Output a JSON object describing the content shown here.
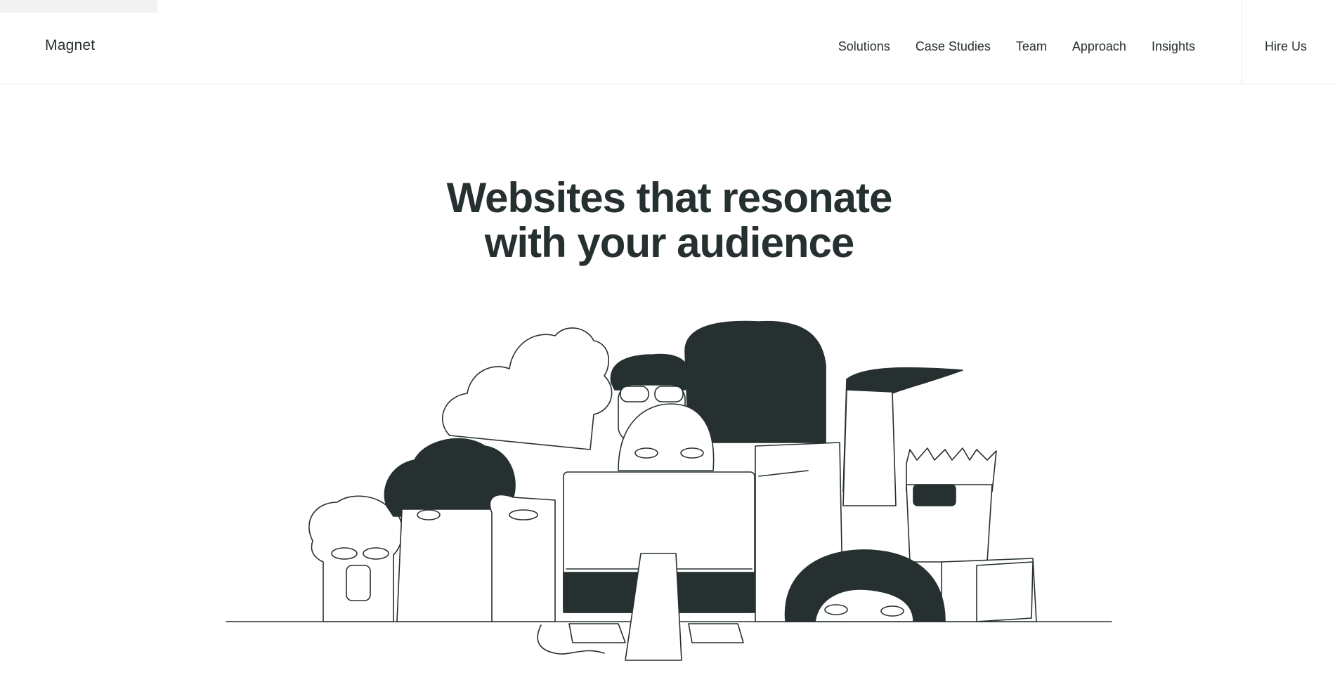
{
  "brand": {
    "name": "Magnet"
  },
  "nav": {
    "items": [
      {
        "label": "Solutions"
      },
      {
        "label": "Case Studies"
      },
      {
        "label": "Team"
      },
      {
        "label": "Approach"
      },
      {
        "label": "Insights"
      }
    ],
    "cta_label": "Hire Us"
  },
  "hero": {
    "title_line1": "Websites that resonate",
    "title_line2": "with your audience"
  },
  "illustration": {
    "icon": "crowd-looking-at-computer-illustration"
  },
  "colors": {
    "ink": "#263030",
    "background": "#ffffff",
    "divider": "#e6e8e8"
  }
}
